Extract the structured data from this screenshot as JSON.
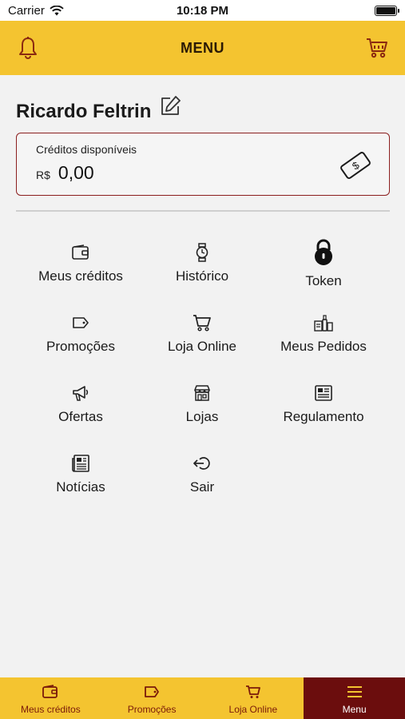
{
  "status_bar": {
    "carrier": "Carrier",
    "time": "10:18 PM"
  },
  "header": {
    "title": "MENU",
    "left_icon": "bell-icon",
    "right_icon": "cart-icon"
  },
  "profile": {
    "name": "Ricardo Feltrin"
  },
  "credits": {
    "label": "Créditos disponíveis",
    "currency": "R$",
    "amount": "0,00"
  },
  "menu": {
    "items": [
      {
        "label": "Meus créditos",
        "icon": "wallet-icon"
      },
      {
        "label": "Histórico",
        "icon": "watch-icon"
      },
      {
        "label": "Token",
        "icon": "lock-icon"
      },
      {
        "label": "Promoções",
        "icon": "tag-icon"
      },
      {
        "label": "Loja Online",
        "icon": "cart-icon"
      },
      {
        "label": "Meus Pedidos",
        "icon": "orders-icon"
      },
      {
        "label": "Ofertas",
        "icon": "megaphone-icon"
      },
      {
        "label": "Lojas",
        "icon": "store-icon"
      },
      {
        "label": "Regulamento",
        "icon": "document-icon"
      },
      {
        "label": "Notícias",
        "icon": "newspaper-icon"
      },
      {
        "label": "Sair",
        "icon": "logout-icon"
      }
    ]
  },
  "tabbar": {
    "tabs": [
      {
        "label": "Meus créditos",
        "icon": "wallet-icon"
      },
      {
        "label": "Promoções",
        "icon": "tag-icon"
      },
      {
        "label": "Loja Online",
        "icon": "cart-icon"
      },
      {
        "label": "Menu",
        "icon": "menu-icon",
        "active": true
      }
    ]
  },
  "colors": {
    "brand_yellow": "#f4c430",
    "brand_dark_red": "#6b0d0d",
    "card_border": "#8b1e1e",
    "background": "#f2f2f2"
  }
}
